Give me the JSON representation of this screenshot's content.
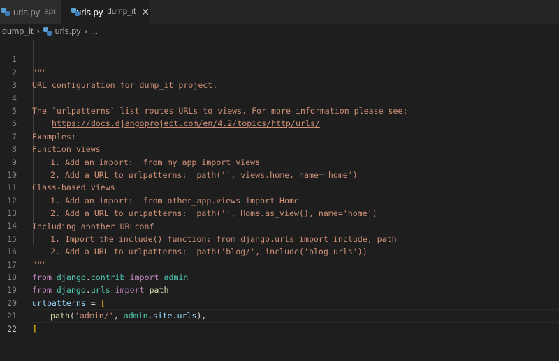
{
  "tabs": [
    {
      "name": "urls.py",
      "desc": "api"
    },
    {
      "name": "urls.py",
      "desc": "dump_it",
      "close": "✕"
    }
  ],
  "breadcrumb": {
    "folder": "dump_it",
    "file": "urls.py",
    "ellipsis": "..."
  },
  "editor": {
    "lines": [
      {
        "n": "1",
        "t": "\"\"\""
      },
      {
        "n": "2",
        "t": "URL configuration for dump_it project."
      },
      {
        "n": "3",
        "t": ""
      },
      {
        "n": "4",
        "t": "The `urlpatterns` list routes URLs to views. For more information please see:"
      },
      {
        "n": "5",
        "t": "https://docs.djangoproject.com/en/4.2/topics/http/urls/"
      },
      {
        "n": "6",
        "t": "Examples:"
      },
      {
        "n": "7",
        "t": "Function views"
      },
      {
        "n": "8",
        "t": "1. Add an import:  from my_app import views"
      },
      {
        "n": "9",
        "t": "2. Add a URL to urlpatterns:  path('', views.home, name='home')"
      },
      {
        "n": "10",
        "t": "Class-based views"
      },
      {
        "n": "11",
        "t": "1. Add an import:  from other_app.views import Home"
      },
      {
        "n": "12",
        "t": "2. Add a URL to urlpatterns:  path('', Home.as_view(), name='home')"
      },
      {
        "n": "13",
        "t": "Including another URLconf"
      },
      {
        "n": "14",
        "t": "1. Import the include() function: from django.urls import include, path"
      },
      {
        "n": "15",
        "t": "2. Add a URL to urlpatterns:  path('blog/', include('blog.urls'))"
      },
      {
        "n": "16",
        "t": "\"\"\""
      },
      {
        "n": "17",
        "t": "from django.contrib import admin"
      },
      {
        "n": "18",
        "t": "from django.urls import path"
      },
      {
        "n": "19",
        "t": "urlpatterns = ["
      },
      {
        "n": "20",
        "t": "path('admin/', admin.site.urls),"
      },
      {
        "n": "21",
        "t": "]"
      },
      {
        "n": "22",
        "t": ""
      }
    ],
    "tokens": {
      "kw_from": "from",
      "kw_import": "import",
      "mod_django": "django",
      "dot": ".",
      "mod_contrib": "contrib",
      "mod_urls": "urls",
      "var_admin": "admin",
      "var_path": "path",
      "var_urlpatterns": "urlpatterns",
      "eq_open": " = ",
      "bracket_open": "[",
      "bracket_close": "]",
      "fn_path": "path",
      "paren_open": "(",
      "str_admin": "'admin/'",
      "comma_sp": ", ",
      "var_site": "site",
      "var_urls": "urls",
      "paren_close_comma": "),"
    }
  },
  "colors": {
    "string": "#ce9178",
    "keyword": "#c586c0",
    "module": "#4ec9b0",
    "variable": "#9cdcfe",
    "function": "#dcdcaa",
    "background": "#1e1e1e"
  }
}
